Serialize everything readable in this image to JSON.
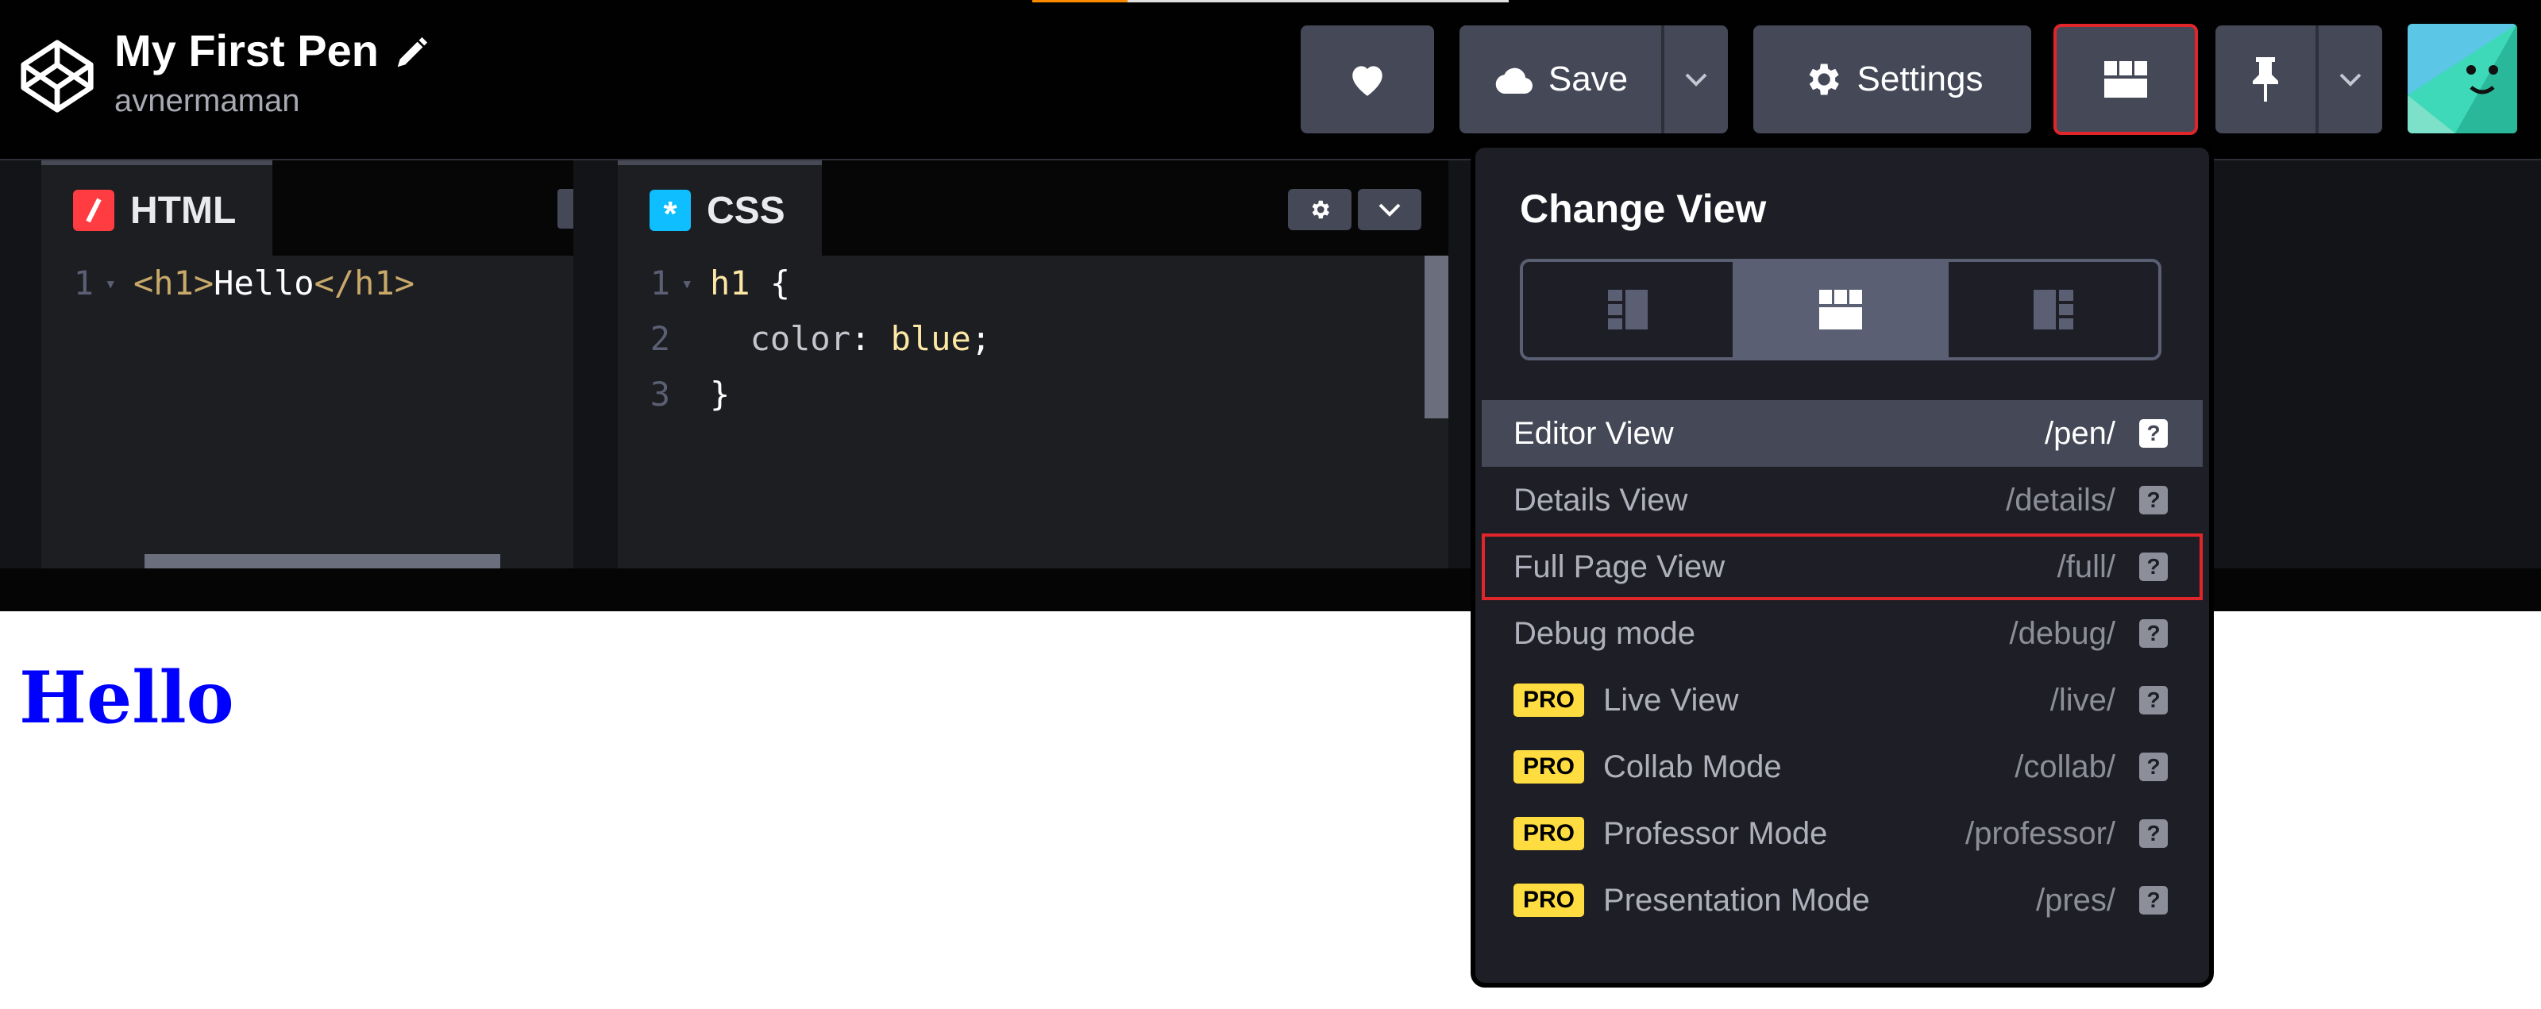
{
  "header": {
    "pen_title": "My First Pen",
    "username": "avnermaman",
    "save_label": "Save",
    "settings_label": "Settings",
    "icons": {
      "logo": "codepen-logo-icon",
      "edit": "pencil-icon",
      "like": "heart-icon",
      "save": "cloud-icon",
      "settings": "gear-icon",
      "layout": "layout-grid-icon",
      "pin": "pin-icon"
    }
  },
  "editors": {
    "html": {
      "tab_label": "HTML",
      "badge_color": "#ff3c41",
      "lines": [
        {
          "num": "1",
          "parts": [
            {
              "text": "<h1>",
              "color": "#c8a96a"
            },
            {
              "text": "Hello",
              "color": "#ffffff"
            },
            {
              "text": "</h1>",
              "color": "#c8a96a"
            }
          ]
        }
      ]
    },
    "css": {
      "tab_label": "CSS",
      "badge_color": "#0ebeff",
      "lines": [
        {
          "num": "1",
          "parts": [
            {
              "text": "h1",
              "color": "#fde7a4"
            },
            {
              "text": " {",
              "color": "#ffffff"
            }
          ]
        },
        {
          "num": "2",
          "parts": [
            {
              "text": "  color",
              "color": "#c4c5cc"
            },
            {
              "text": ": ",
              "color": "#ffffff"
            },
            {
              "text": "blue",
              "color": "#fde7a4"
            },
            {
              "text": ";",
              "color": "#ffffff"
            }
          ]
        },
        {
          "num": "3",
          "parts": [
            {
              "text": "}",
              "color": "#ffffff"
            }
          ]
        }
      ]
    }
  },
  "preview": {
    "heading": "Hello",
    "heading_color": "#0000ff"
  },
  "change_view": {
    "title": "Change View",
    "layout_options": [
      {
        "name": "layout-left-icon",
        "active": false
      },
      {
        "name": "layout-top-icon",
        "active": true
      },
      {
        "name": "layout-right-icon",
        "active": false
      }
    ],
    "items": [
      {
        "label": "Editor View",
        "path": "/pen/",
        "pro": false,
        "active": true,
        "outlined": false
      },
      {
        "label": "Details View",
        "path": "/details/",
        "pro": false,
        "active": false,
        "outlined": false
      },
      {
        "label": "Full Page View",
        "path": "/full/",
        "pro": false,
        "active": false,
        "outlined": true
      },
      {
        "label": "Debug mode",
        "path": "/debug/",
        "pro": false,
        "active": false,
        "outlined": false
      },
      {
        "label": "Live View",
        "path": "/live/",
        "pro": true,
        "active": false,
        "outlined": false
      },
      {
        "label": "Collab Mode",
        "path": "/collab/",
        "pro": true,
        "active": false,
        "outlined": false
      },
      {
        "label": "Professor Mode",
        "path": "/professor/",
        "pro": true,
        "active": false,
        "outlined": false
      },
      {
        "label": "Presentation Mode",
        "path": "/pres/",
        "pro": true,
        "active": false,
        "outlined": false
      }
    ],
    "pro_badge": "PRO",
    "help_glyph": "?"
  },
  "colors": {
    "button_bg": "#444857",
    "highlight_red": "#e0262b",
    "pro_yellow": "#ffdd40"
  }
}
